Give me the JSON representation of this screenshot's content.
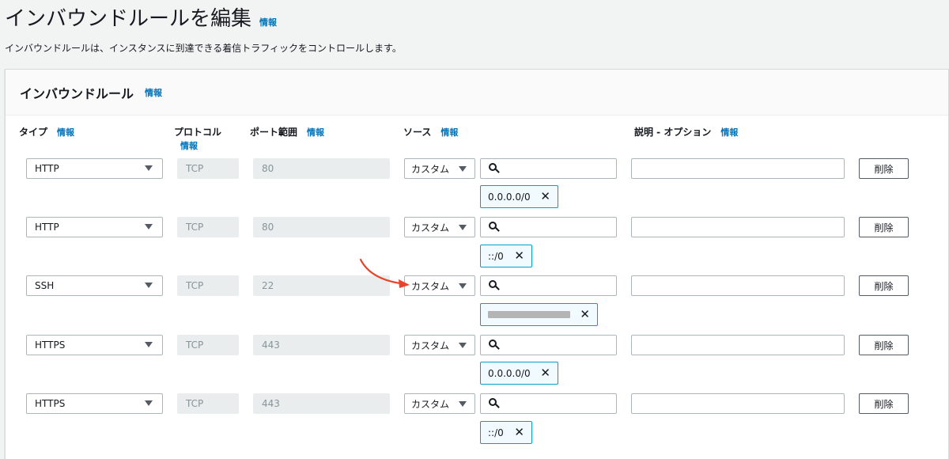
{
  "page": {
    "title": "インバウンドルールを編集",
    "info": "情報",
    "description": "インバウンドルールは、インスタンスに到達できる着信トラフィックをコントロールします。"
  },
  "panel": {
    "title": "インバウンドルール",
    "info": "情報"
  },
  "columns": {
    "type": "タイプ",
    "protocol": "プロトコル",
    "port": "ポート範囲",
    "source": "ソース",
    "desc": "説明 - オプション",
    "info": "情報"
  },
  "rules": [
    {
      "type": "HTTP",
      "protocol": "TCP",
      "port": "80",
      "source": "カスタム",
      "cidr": "0.0.0.0/0",
      "delete": "削除"
    },
    {
      "type": "HTTP",
      "protocol": "TCP",
      "port": "80",
      "source": "カスタム",
      "cidr": "::/0",
      "delete": "削除"
    },
    {
      "type": "SSH",
      "protocol": "TCP",
      "port": "22",
      "source": "カスタム",
      "cidr": "",
      "delete": "削除"
    },
    {
      "type": "HTTPS",
      "protocol": "TCP",
      "port": "443",
      "source": "カスタム",
      "cidr": "0.0.0.0/0",
      "delete": "削除"
    },
    {
      "type": "HTTPS",
      "protocol": "TCP",
      "port": "443",
      "source": "カスタム",
      "cidr": "::/0",
      "delete": "削除"
    }
  ],
  "colors": {
    "link": "#0073bb",
    "token_border": "#00a1c9",
    "token_bg": "#f1faff",
    "annotation_arrow": "#e8432b"
  },
  "icons": {
    "caret": "caret-down-icon",
    "search": "search-icon",
    "remove": "close-icon",
    "arrow": "annotation-arrow-icon"
  }
}
